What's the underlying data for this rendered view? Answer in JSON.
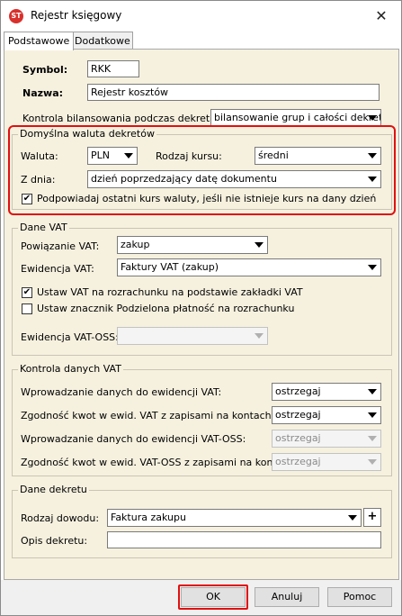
{
  "window": {
    "title": "Rejestr księgowy",
    "app_icon_text": "ST"
  },
  "tabs": [
    {
      "label": "Podstawowe"
    },
    {
      "label": "Dodatkowe"
    }
  ],
  "fields": {
    "symbol_label": "Symbol:",
    "symbol_value": "RKK",
    "nazwa_label": "Nazwa:",
    "nazwa_value": "Rejestr kosztów",
    "kontrola_label": "Kontrola bilansowania podczas dekretacji:",
    "kontrola_value": "bilansowanie grup i całości dekretu"
  },
  "waluta_group": {
    "title": "Domyślna waluta dekretów",
    "waluta_label": "Waluta:",
    "waluta_value": "PLN",
    "rodzaj_kursu_label": "Rodzaj kursu:",
    "rodzaj_kursu_value": "średni",
    "z_dnia_label": "Z dnia:",
    "z_dnia_value": "dzień poprzedzający datę dokumentu",
    "podpowiadaj_label": "Podpowiadaj ostatni kurs waluty, jeśli nie istnieje kurs na dany dzień",
    "podpowiadaj_checked": true
  },
  "vat_group": {
    "title": "Dane VAT",
    "powiazanie_label": "Powiązanie VAT:",
    "powiazanie_value": "zakup",
    "ewidencja_label": "Ewidencja VAT:",
    "ewidencja_value": "Faktury VAT (zakup)",
    "ustaw_vat_label": "Ustaw VAT na rozrachunku na podstawie zakładki VAT",
    "ustaw_vat_checked": true,
    "ustaw_znacznik_label": "Ustaw znacznik Podzielona płatność na rozrachunku",
    "ustaw_znacznik_checked": false,
    "ewidencja_oss_label": "Ewidencja VAT-OSS:",
    "ewidencja_oss_value": ""
  },
  "kontrola_group": {
    "title": "Kontrola danych VAT",
    "rows": [
      {
        "label": "Wprowadzanie danych do ewidencji VAT:",
        "value": "ostrzegaj",
        "disabled": false
      },
      {
        "label": "Zgodność kwot w ewid. VAT z zapisami na kontach:",
        "value": "ostrzegaj",
        "disabled": false
      },
      {
        "label": "Wprowadzanie danych do ewidencji VAT-OSS:",
        "value": "ostrzegaj",
        "disabled": true
      },
      {
        "label": "Zgodność kwot w ewid. VAT-OSS z zapisami na kontach:",
        "value": "ostrzegaj",
        "disabled": true
      }
    ]
  },
  "dekret_group": {
    "title": "Dane dekretu",
    "rodzaj_dowodu_label": "Rodzaj dowodu:",
    "rodzaj_dowodu_value": "Faktura zakupu",
    "add_label": "+",
    "opis_label": "Opis dekretu:",
    "opis_value": ""
  },
  "buttons": {
    "ok": "OK",
    "anuluj": "Anuluj",
    "pomoc": "Pomoc",
    "close": "✕"
  },
  "colors": {
    "highlight": "#e01010",
    "panel_bg": "#f6f1df"
  }
}
